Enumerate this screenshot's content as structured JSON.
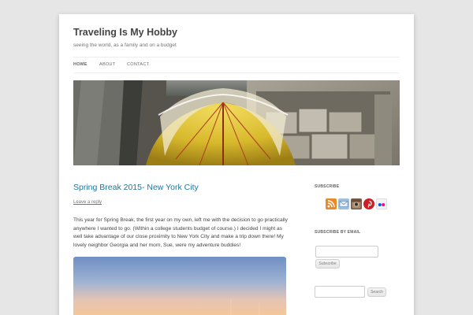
{
  "site": {
    "title": "Traveling Is My Hobby",
    "description": "seeing the world, as a family and on a budget"
  },
  "nav": {
    "items": [
      {
        "label": "HOME",
        "current": true
      },
      {
        "label": "ABOUT",
        "current": false
      },
      {
        "label": "CONTACT",
        "current": false
      }
    ]
  },
  "post": {
    "title": "Spring Break 2015- New York City",
    "leave_reply": "Leave a reply",
    "paragraph": "This year for Spring Break, the first year on my own, left me with the decision to go practically anywhere I wanted to go. (Within a college students budget of course.) I decided I might as well take advantage of our close proximity to New York City and make a trip down there! My lovely neighbor Georgia and her mom, Sue, were my adventure buddies!"
  },
  "sidebar": {
    "subscribe_title": "SUBSCRIBE",
    "subscribe_icons": [
      "rss-icon",
      "email-icon",
      "instagram-icon",
      "pinterest-icon",
      "flickr-icon"
    ],
    "subscribe_email_title": "SUBSCRIBE BY EMAIL",
    "subscribe_button": "Subscribe",
    "search_button": "Search"
  },
  "colors": {
    "link": "#21759b",
    "background": "#e6e6e6"
  }
}
